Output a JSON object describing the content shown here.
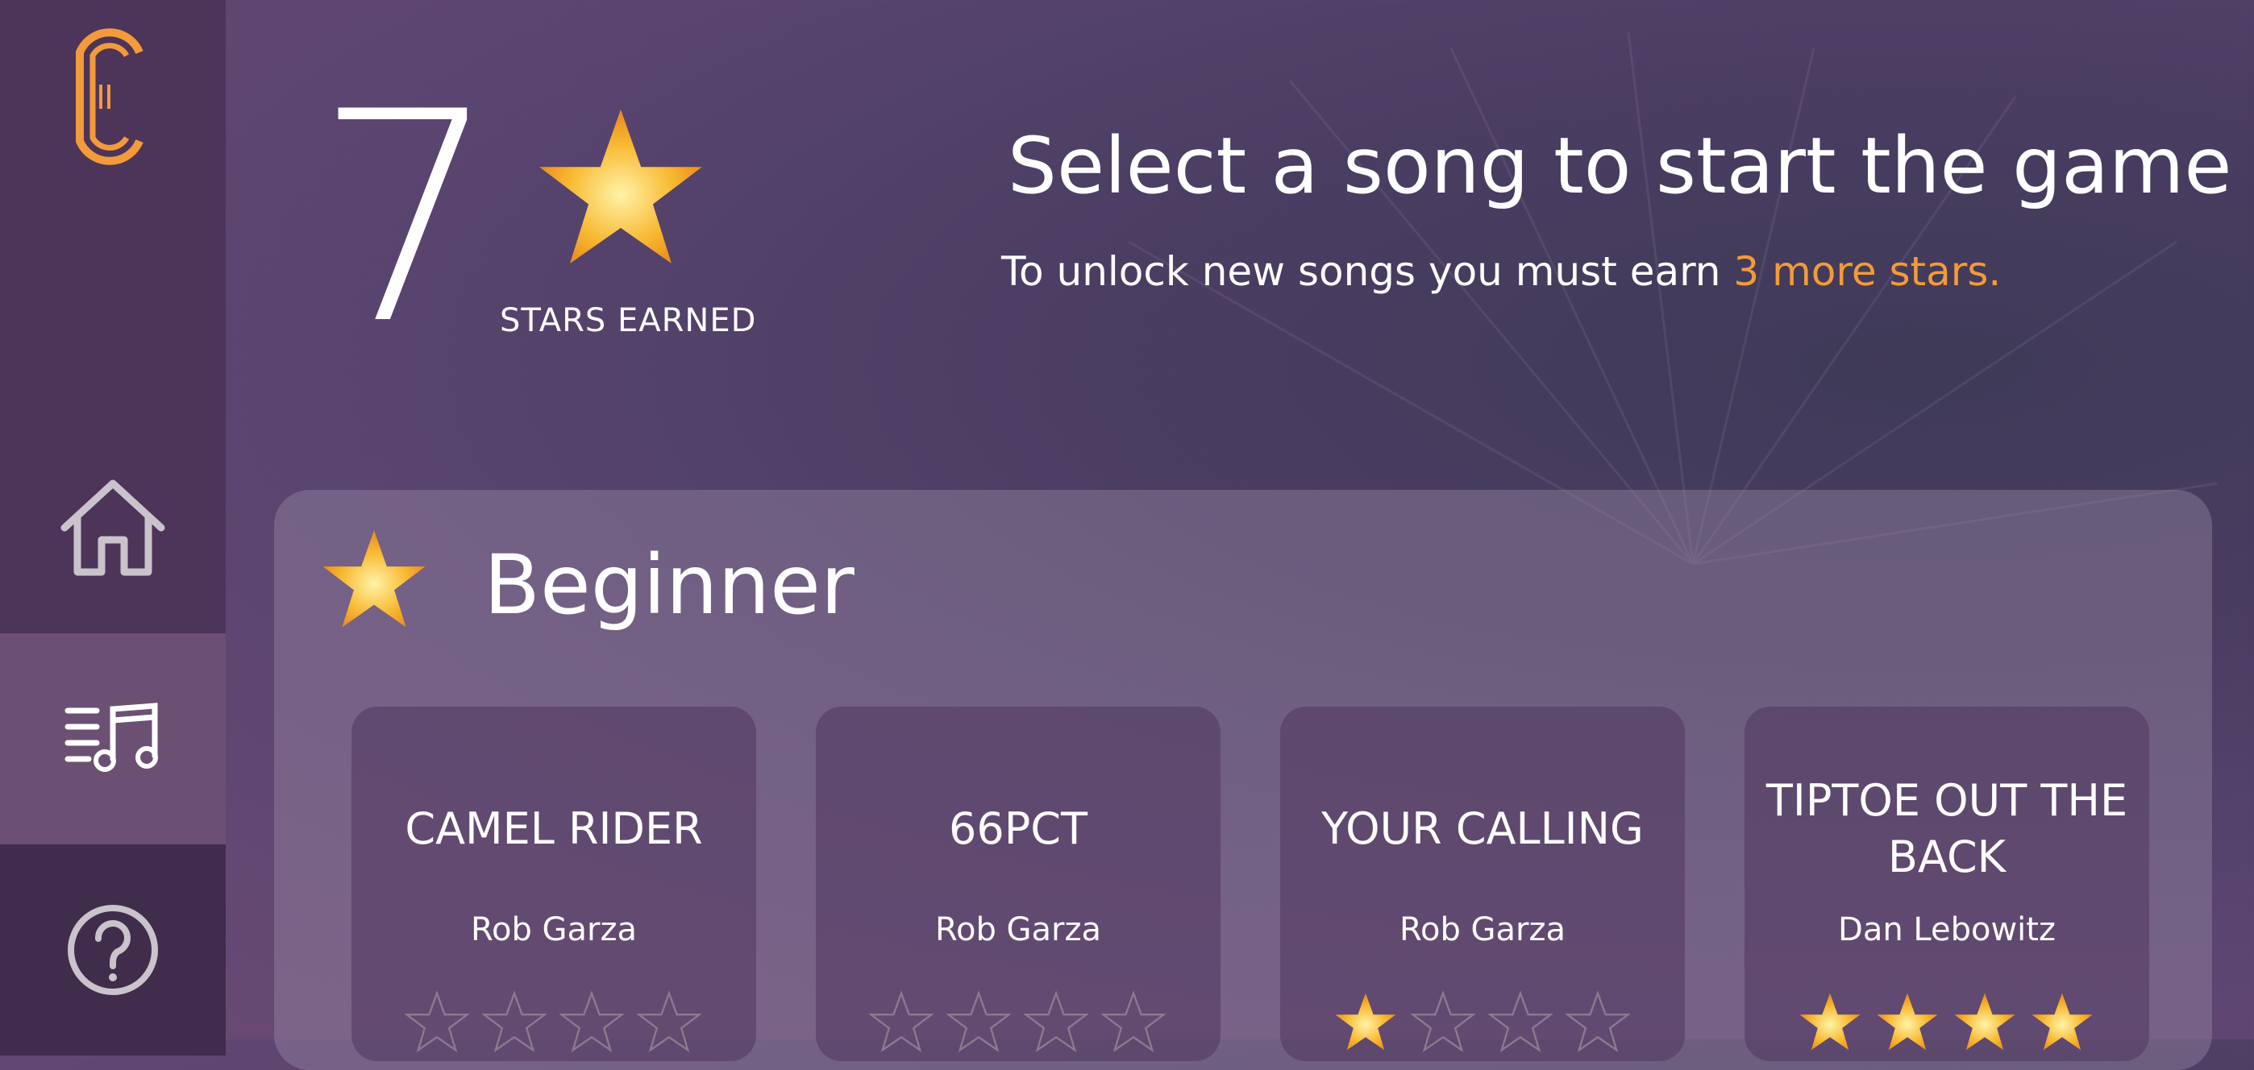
{
  "header": {
    "stars_earned": "7",
    "stars_earned_label": "STARS EARNED",
    "title": "Select a song to start the game",
    "unlock_prefix": "To unlock new songs you must earn ",
    "unlock_highlight": "3 more stars."
  },
  "sidebar": {
    "items": [
      {
        "name": "home",
        "icon": "home-icon"
      },
      {
        "name": "songs",
        "icon": "music-list-icon",
        "selected": true
      },
      {
        "name": "help",
        "icon": "help-icon"
      }
    ]
  },
  "colors": {
    "accent": "#f39a3b",
    "star_fill": "#f8b830",
    "sidebar": "#4d3459",
    "sidebar_selected": "#6b5074"
  },
  "level": {
    "title": "Beginner",
    "songs": [
      {
        "title": "CAMEL RIDER",
        "artist": "Rob Garza",
        "stars": 0
      },
      {
        "title": "66PCT",
        "artist": "Rob Garza",
        "stars": 0
      },
      {
        "title": "YOUR CALLING",
        "artist": "Rob Garza",
        "stars": 1
      },
      {
        "title": "TIPTOE OUT THE BACK",
        "artist": "Dan Lebowitz",
        "stars": 4
      }
    ]
  }
}
